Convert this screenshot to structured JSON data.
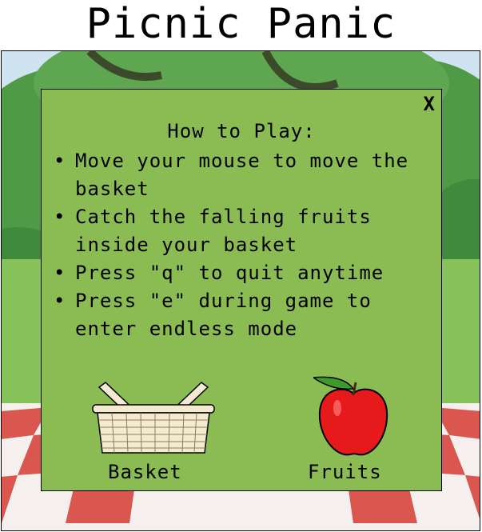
{
  "title": "Picnic Panic",
  "dialog": {
    "close_label": "X",
    "heading": "How to Play:",
    "rules": [
      "Move your mouse to move the basket",
      "Catch the falling fruits inside your basket",
      "Press \"q\" to quit anytime",
      "Press \"e\" during game to enter endless mode"
    ],
    "legend": {
      "basket_label": "Basket",
      "fruits_label": "Fruits"
    }
  },
  "icons": {
    "basket": "basket-icon",
    "fruit": "apple-icon",
    "close": "close-icon"
  },
  "colors": {
    "panel": "#8bbb53",
    "sky": "#cfe3f0",
    "trees": "#4f9a47",
    "grass": "#86c15a",
    "tablecloth_red": "#d9574f",
    "tablecloth_white": "#f5f0ee"
  }
}
